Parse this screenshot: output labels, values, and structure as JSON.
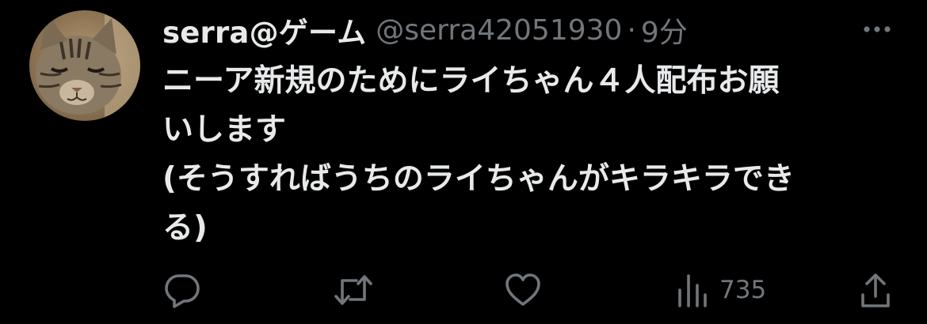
{
  "tweet": {
    "author": {
      "display_name": "serra@ゲーム",
      "handle": "@serra42051930",
      "avatar_icon": "cat-avatar-icon"
    },
    "separator": "·",
    "time": "9分",
    "text_lines": [
      "ニーア新規のためにライちゃん４人配布お願",
      "いします",
      "(そうすればうちのライちゃんがキラキラでき",
      "る)"
    ]
  },
  "actions": {
    "reply_icon": "reply-icon",
    "retweet_icon": "retweet-icon",
    "like_icon": "heart-icon",
    "views_icon": "views-icon",
    "views_count": "735",
    "share_icon": "share-icon",
    "more_icon": "more-icon"
  },
  "colors": {
    "background": "#000000",
    "primary_text": "#e7e9ea",
    "secondary_text": "#71767b"
  }
}
